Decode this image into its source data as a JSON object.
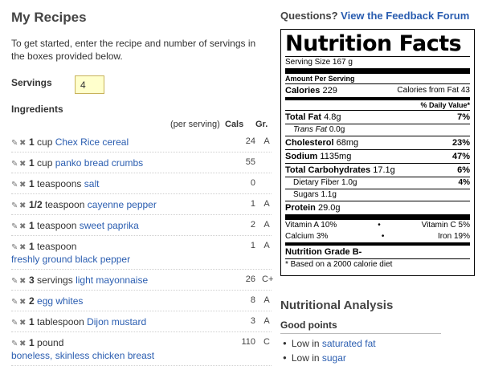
{
  "page_title": "My Recipes",
  "intro": "To get started, enter the recipe and number of servings in the boxes provided below.",
  "servings": {
    "label": "Servings",
    "value": "4"
  },
  "ingredients": {
    "heading": "Ingredients",
    "col_per_serving": "(per serving)",
    "col_cals": "Cals",
    "col_grade": "Gr.",
    "edit_icon": "pencil-icon",
    "remove_icon": "x-icon",
    "rows": [
      {
        "qty": "1",
        "unit": "cup",
        "name": "Chex Rice cereal",
        "cals": "24",
        "grade": "A"
      },
      {
        "qty": "1",
        "unit": "cup",
        "name": "panko bread crumbs",
        "cals": "55",
        "grade": ""
      },
      {
        "qty": "1",
        "unit": "teaspoons",
        "name": "salt",
        "cals": "0",
        "grade": ""
      },
      {
        "qty": "1/2",
        "unit": "teaspoon",
        "name": "cayenne pepper",
        "cals": "1",
        "grade": "A"
      },
      {
        "qty": "1",
        "unit": "teaspoon",
        "name": "sweet paprika",
        "cals": "2",
        "grade": "A"
      },
      {
        "qty": "1",
        "unit": "teaspoon",
        "name": "freshly ground black pepper",
        "cals": "1",
        "grade": "A",
        "wrap": true
      },
      {
        "qty": "3",
        "unit": "servings",
        "name": "light mayonnaise",
        "cals": "26",
        "grade": "C+"
      },
      {
        "qty": "2",
        "unit": "",
        "name": "egg whites",
        "cals": "8",
        "grade": "A"
      },
      {
        "qty": "1",
        "unit": "tablespoon",
        "name": "Dijon mustard",
        "cals": "3",
        "grade": "A"
      },
      {
        "qty": "1",
        "unit": "pound",
        "name": "boneless, skinless chicken breast",
        "cals": "110",
        "grade": "C",
        "wrap": true
      }
    ]
  },
  "questions": {
    "text": "Questions?",
    "link": "View the Feedback Forum"
  },
  "nutrition": {
    "title": "Nutrition Facts",
    "serving_size": "Serving Size 167 g",
    "amount_per_serving": "Amount Per Serving",
    "calories_label": "Calories",
    "calories_value": "229",
    "calories_fat": "Calories from Fat 43",
    "daily_value_header": "% Daily Value*",
    "total_fat_label": "Total Fat",
    "total_fat_value": "4.8g",
    "total_fat_pct": "7%",
    "trans_fat_label": "Trans Fat",
    "trans_fat_value": "0.0g",
    "cholesterol_label": "Cholesterol",
    "cholesterol_value": "68mg",
    "cholesterol_pct": "23%",
    "sodium_label": "Sodium",
    "sodium_value": "1135mg",
    "sodium_pct": "47%",
    "carbs_label": "Total Carbohydrates",
    "carbs_value": "17.1g",
    "carbs_pct": "6%",
    "fiber_label": "Dietary Fiber",
    "fiber_value": "1.0g",
    "fiber_pct": "4%",
    "sugars_label": "Sugars",
    "sugars_value": "1.1g",
    "protein_label": "Protein",
    "protein_value": "29.0g",
    "vitamin_a": "Vitamin A 10%",
    "vitamin_c": "Vitamin C 5%",
    "calcium": "Calcium 3%",
    "iron": "Iron 19%",
    "bullet": "•",
    "grade": "Nutrition Grade B-",
    "footnote": "* Based on a 2000 calorie diet"
  },
  "analysis": {
    "title": "Nutritional Analysis",
    "good_points_label": "Good points",
    "good_points": [
      {
        "prefix": "Low in",
        "link": "saturated fat"
      },
      {
        "prefix": "Low in",
        "link": "sugar"
      }
    ]
  }
}
